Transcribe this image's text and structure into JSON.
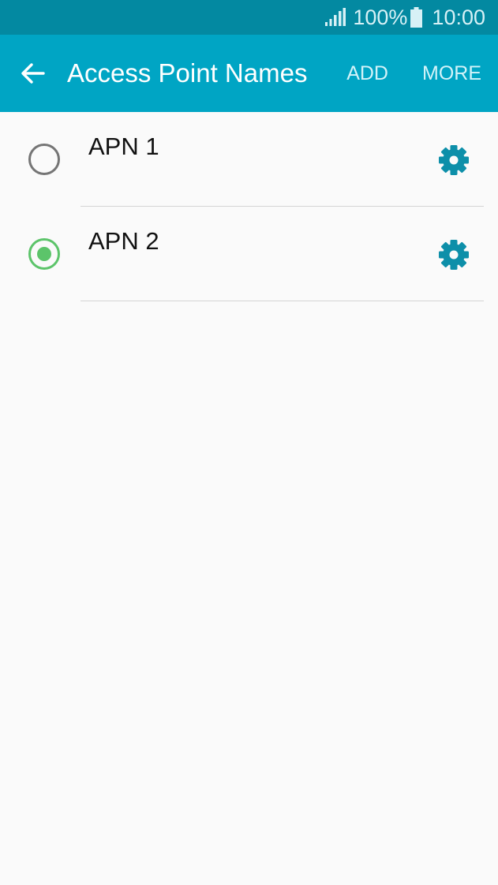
{
  "status_bar": {
    "battery_percent": "100%",
    "time": "10:00",
    "icons": [
      "signal-icon",
      "battery-icon"
    ]
  },
  "app_bar": {
    "back_icon": "arrow-left-icon",
    "title": "Access Point Names",
    "add_label": "ADD",
    "more_label": "MORE"
  },
  "apn_list": {
    "items": [
      {
        "name": "APN 1",
        "selected": false,
        "settings_icon": "gear-icon"
      },
      {
        "name": "APN 2",
        "selected": true,
        "settings_icon": "gear-icon"
      }
    ]
  },
  "colors": {
    "status_bar_bg": "#0389a1",
    "app_bar_bg": "#00a5c4",
    "accent_gear": "#0d8fa9",
    "radio_selected": "#5cc46a",
    "radio_unselected": "#757575",
    "background": "#fafafa"
  }
}
